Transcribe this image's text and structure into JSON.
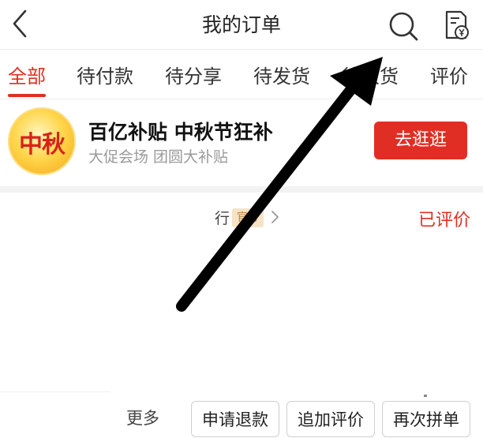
{
  "header": {
    "title": "我的订单",
    "back_icon": "chevron-left-icon",
    "search_icon": "search-icon",
    "bill_icon": "yen-bill-icon"
  },
  "tabs": [
    {
      "label": "全部",
      "active": true
    },
    {
      "label": "待付款",
      "active": false
    },
    {
      "label": "待分享",
      "active": false
    },
    {
      "label": "待发货",
      "active": false
    },
    {
      "label": "待收货",
      "active": false
    },
    {
      "label": "评价",
      "active": false
    }
  ],
  "promo": {
    "logo_text": "中秋",
    "title": "百亿补贴 中秋节狂补",
    "subtitle": "大促会场 团圆大补贴",
    "button_label": "去逛逛"
  },
  "order": {
    "shop_name_fragment": "行",
    "badge": "官方",
    "status": "已评价"
  },
  "actions": {
    "more_label": "更多",
    "buttons": [
      "申请退款",
      "追加评价",
      "再次拼单"
    ]
  },
  "colors": {
    "accent": "#e02e24",
    "annotation_arrow": "#000000"
  }
}
